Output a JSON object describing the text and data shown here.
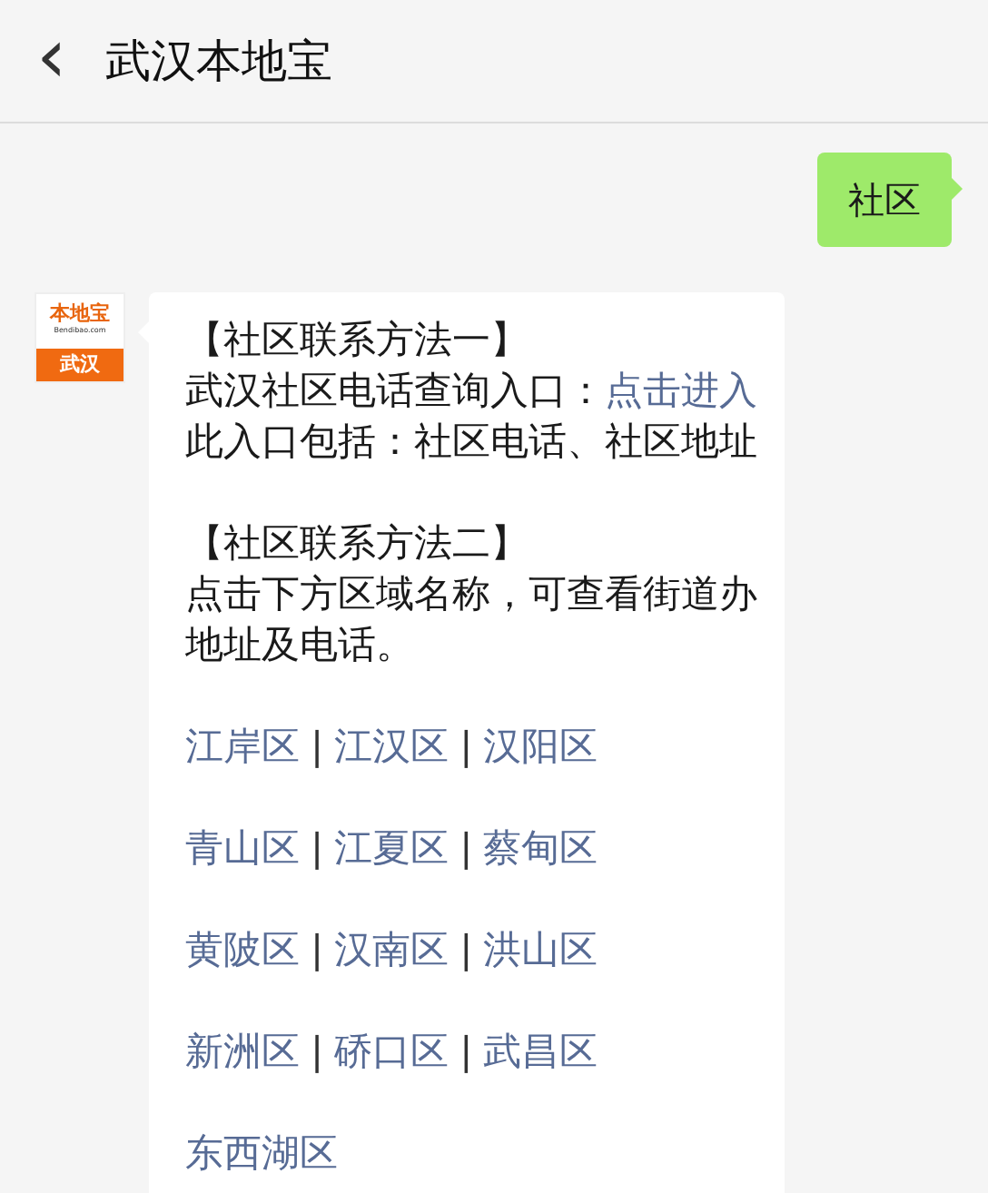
{
  "header": {
    "back_icon": "‹",
    "title": "武汉本地宝"
  },
  "sent_message": {
    "text": "社区"
  },
  "sender_avatar": {
    "brand": "本地宝",
    "site": "Bendibao.com",
    "city": "武汉"
  },
  "reply": {
    "sections": [
      {
        "heading": "【社区联系方法一】",
        "lines": [
          {
            "text": "武汉社区电话查询入口：",
            "link": "点击进入"
          },
          {
            "text": "此入口包括：社区电话、社区地址"
          }
        ]
      },
      {
        "heading": "【社区联系方法二】",
        "lines": [
          {
            "text": "点击下方区域名称，可查看街道办地址及电话。"
          }
        ]
      }
    ],
    "district_rows": [
      {
        "items": [
          {
            "kind": "link",
            "text": "江岸区"
          },
          {
            "kind": "separator",
            "text": "|"
          },
          {
            "kind": "link",
            "text": "江汉区"
          },
          {
            "kind": "separator",
            "text": "|"
          },
          {
            "kind": "link",
            "text": "汉阳区"
          }
        ]
      },
      {
        "items": [
          {
            "kind": "link",
            "text": "青山区"
          },
          {
            "kind": "separator",
            "text": "|"
          },
          {
            "kind": "link",
            "text": "江夏区"
          },
          {
            "kind": "separator",
            "text": "|"
          },
          {
            "kind": "link",
            "text": "蔡甸区"
          }
        ]
      },
      {
        "items": [
          {
            "kind": "link",
            "text": "黄陂区"
          },
          {
            "kind": "separator",
            "text": "|"
          },
          {
            "kind": "link",
            "text": "汉南区"
          },
          {
            "kind": "separator",
            "text": "|"
          },
          {
            "kind": "link",
            "text": "洪山区"
          }
        ]
      },
      {
        "items": [
          {
            "kind": "link",
            "text": "新洲区"
          },
          {
            "kind": "separator",
            "text": "|"
          },
          {
            "kind": "link",
            "text": "硚口区"
          },
          {
            "kind": "separator",
            "text": "|"
          },
          {
            "kind": "link",
            "text": "武昌区"
          }
        ]
      },
      {
        "items": [
          {
            "kind": "link",
            "text": "东西湖区"
          }
        ]
      }
    ]
  }
}
